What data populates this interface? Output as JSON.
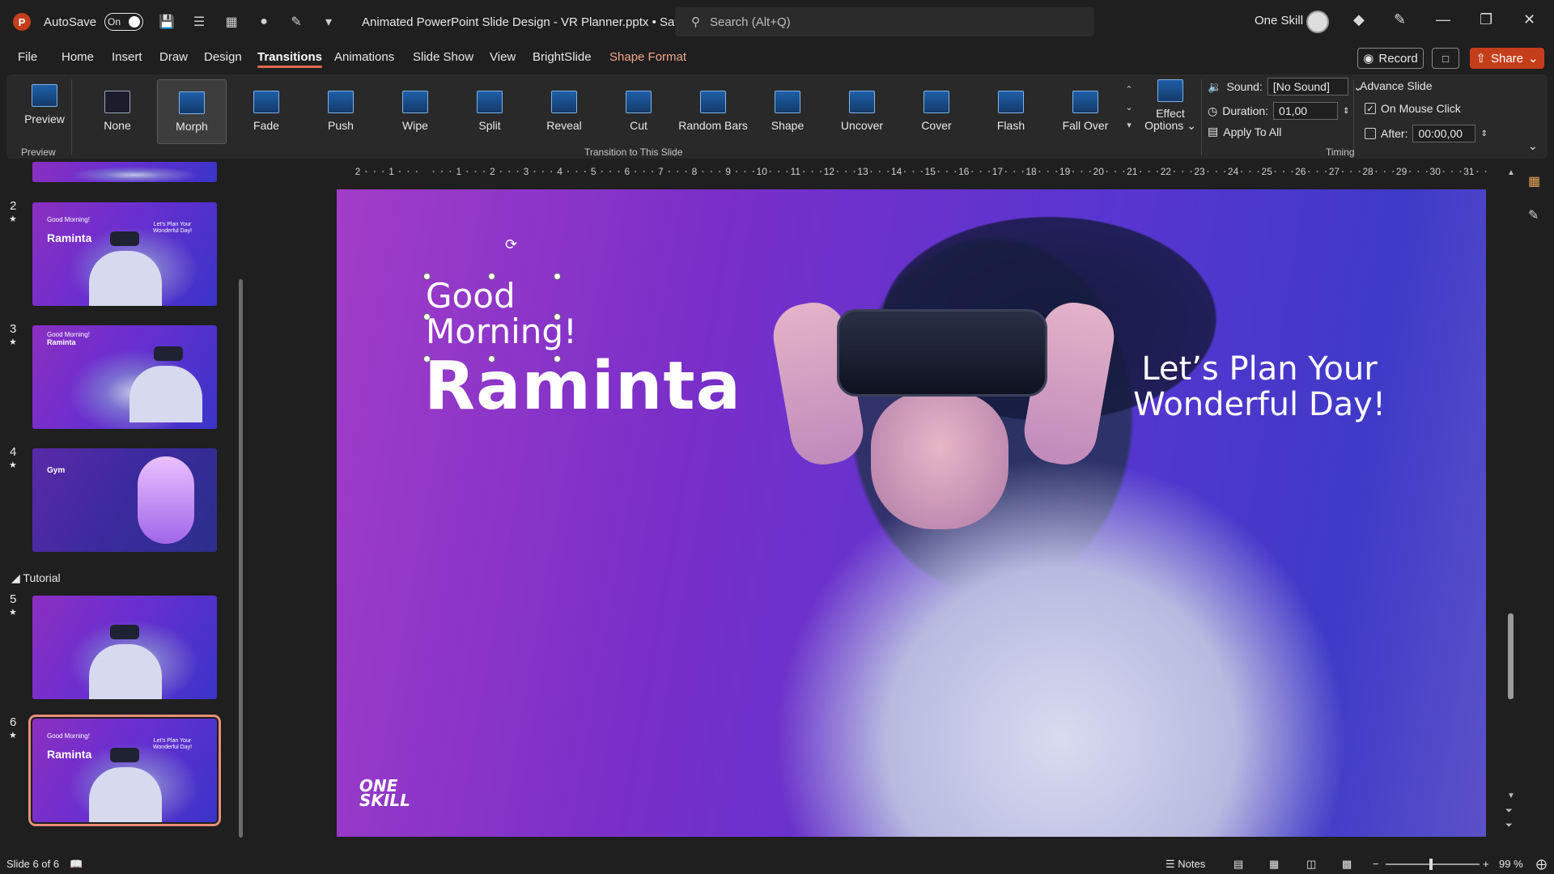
{
  "titlebar": {
    "app_logo": "P",
    "autosave_label": "AutoSave",
    "autosave_state": "On",
    "doc_title": "Animated PowerPoint Slide Design - VR Planner.pptx • Saving...",
    "search_placeholder": "Search (Alt+Q)",
    "user_name": "One Skill"
  },
  "tabs": [
    "File",
    "Home",
    "Insert",
    "Draw",
    "Design",
    "Transitions",
    "Animations",
    "Slide Show",
    "View",
    "BrightSlide",
    "Shape Format"
  ],
  "active_tab": "Transitions",
  "actions": {
    "record": "Record",
    "share": "Share"
  },
  "ribbon": {
    "preview_label": "Preview",
    "preview_group": "Preview",
    "transitions": [
      "None",
      "Morph",
      "Fade",
      "Push",
      "Wipe",
      "Split",
      "Reveal",
      "Cut",
      "Random Bars",
      "Shape",
      "Uncover",
      "Cover",
      "Flash",
      "Fall Over"
    ],
    "selected_transition": "Morph",
    "effect_options_line1": "Effect",
    "effect_options_line2": "Options",
    "transition_group": "Transition to This Slide",
    "sound_label": "Sound:",
    "sound_value": "[No Sound]",
    "duration_label": "Duration:",
    "duration_value": "01,00",
    "apply_all": "Apply To All",
    "advance_slide": "Advance Slide",
    "on_mouse_click": "On Mouse Click",
    "on_mouse_click_checked": true,
    "after_label": "After:",
    "after_value": "00:00,00",
    "timing_group": "Timing"
  },
  "thumbnails": [
    {
      "num": "2",
      "good": "Good Morning!",
      "name": "Raminta",
      "right": "Let's Plan Your Wonderful Day!"
    },
    {
      "num": "3",
      "good": "Good Morning!",
      "name": "Raminta",
      "right": ""
    },
    {
      "num": "4",
      "good": "Gym",
      "name": "",
      "right": ""
    },
    {
      "num": "5",
      "good": "",
      "name": "",
      "right": ""
    },
    {
      "num": "6",
      "good": "Good Morning!",
      "name": "Raminta",
      "right": "Let's Plan Your Wonderful Day!"
    }
  ],
  "section_label": "Tutorial",
  "slide": {
    "greeting_line1": "Good",
    "greeting_line2": "Morning!",
    "name": "Raminta",
    "right_line1": "Let’s Plan Your",
    "right_line2": "Wonderful Day!",
    "logo_line1": "ONE",
    "logo_line2": "SKILL"
  },
  "hruler_labels": [
    "2",
    "1",
    "",
    "1",
    "2",
    "3",
    "4",
    "5",
    "6",
    "7",
    "8",
    "9",
    "10",
    "11",
    "12",
    "13",
    "14",
    "15",
    "16",
    "17",
    "18",
    "19",
    "20",
    "21",
    "22",
    "23",
    "24",
    "25",
    "26",
    "27",
    "28",
    "29",
    "30",
    "31"
  ],
  "status": {
    "slide_info": "Slide 6 of 6",
    "notes": "Notes",
    "zoom": "99 %"
  }
}
